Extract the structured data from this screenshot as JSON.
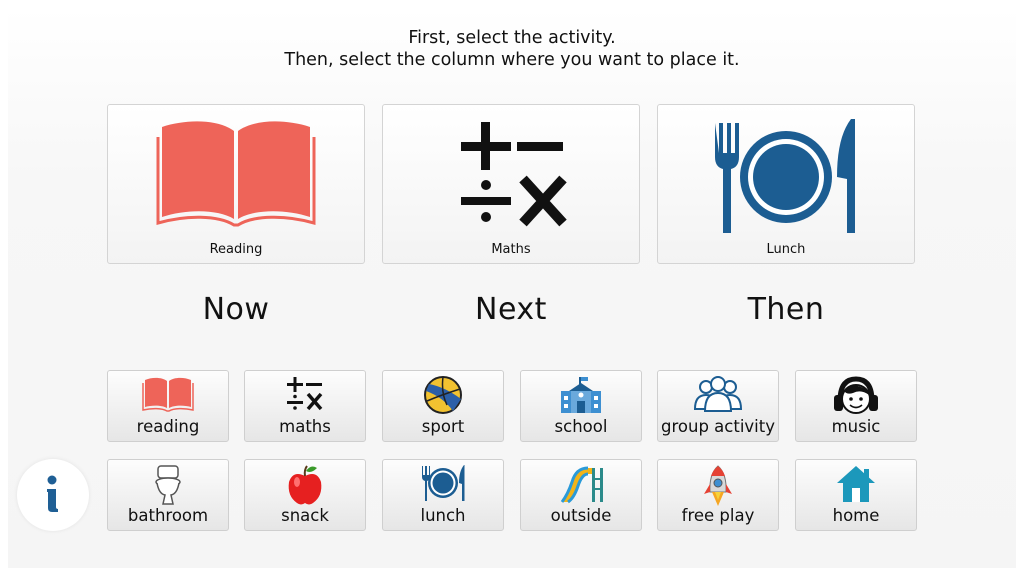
{
  "instructions": {
    "line1": "First, select the activity.",
    "line2": "Then, select the column where you want to place it."
  },
  "schedule": [
    {
      "label": "Reading",
      "icon": "book-icon"
    },
    {
      "label": "Maths",
      "icon": "math-symbols-icon"
    },
    {
      "label": "Lunch",
      "icon": "plate-cutlery-icon"
    }
  ],
  "columns": [
    "Now",
    "Next",
    "Then"
  ],
  "activities": [
    {
      "label": "reading",
      "icon": "book-icon"
    },
    {
      "label": "maths",
      "icon": "math-symbols-icon"
    },
    {
      "label": "sport",
      "icon": "volleyball-icon"
    },
    {
      "label": "school",
      "icon": "school-building-icon"
    },
    {
      "label": "group activity",
      "icon": "people-group-icon"
    },
    {
      "label": "music",
      "icon": "headphones-icon"
    },
    {
      "label": "bathroom",
      "icon": "toilet-icon"
    },
    {
      "label": "snack",
      "icon": "apple-icon"
    },
    {
      "label": "lunch",
      "icon": "plate-cutlery-icon"
    },
    {
      "label": "outside",
      "icon": "slide-icon"
    },
    {
      "label": "free play",
      "icon": "rocket-icon"
    },
    {
      "label": "home",
      "icon": "house-icon"
    }
  ],
  "info_button": {
    "icon": "info-icon"
  },
  "colors": {
    "book": "#ee6459",
    "plate": "#1c5d92",
    "house": "#1c98bb",
    "accent_blue": "#1f5f95"
  }
}
